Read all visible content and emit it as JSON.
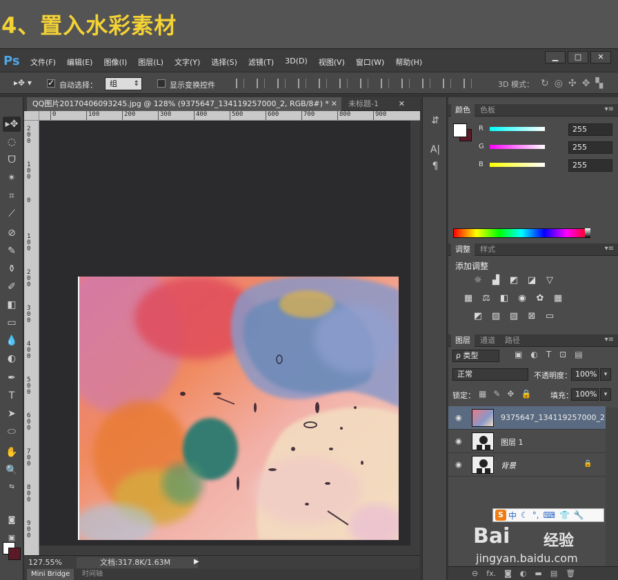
{
  "banner": {
    "title": "4、置入水彩素材"
  },
  "app": {
    "logo": "Ps",
    "menus": [
      "文件(F)",
      "编辑(E)",
      "图像(I)",
      "图层(L)",
      "文字(Y)",
      "选择(S)",
      "滤镜(T)",
      "3D(D)",
      "视图(V)",
      "窗口(W)",
      "帮助(H)"
    ],
    "window_buttons": [
      "▁",
      "□",
      "✕"
    ]
  },
  "options": {
    "tool_icon": "move-tool-icon",
    "auto_select_label": "自动选择：",
    "auto_select_checked": true,
    "auto_select_value": "组",
    "show_transform_label": "显示变换控件",
    "show_transform_checked": false,
    "mode3d_label": "3D 模式："
  },
  "document": {
    "active_tab": "QQ图片20170406093245.jpg @ 128% (9375647_134119257000_2, RGB/8#) *",
    "inactive_tab": "未标题-1",
    "ruler_top": [
      "0",
      "100",
      "200",
      "300",
      "400",
      "500",
      "600",
      "700",
      "800",
      "900"
    ],
    "ruler_left": [
      "2 0 0",
      "1 0 0",
      "0",
      "1 0 0",
      "2 0 0",
      "3 0 0",
      "4 0 0",
      "5 0 0",
      "6 0 0",
      "7 0 0",
      "8 0 0",
      "9 0 0"
    ],
    "zoom": "127.55%",
    "doc_info": "文档:317.8K/1.63M",
    "bottom_tabs": [
      "Mini Bridge",
      "时间轴"
    ]
  },
  "color_panel": {
    "tabs": [
      "颜色",
      "色板"
    ],
    "channels": [
      {
        "letter": "R",
        "value": "255"
      },
      {
        "letter": "G",
        "value": "255"
      },
      {
        "letter": "B",
        "value": "255"
      }
    ],
    "fg_color": "#ffffff",
    "bg_color": "#5a1a28"
  },
  "adjust_panel": {
    "tabs": [
      "调整",
      "样式"
    ],
    "title": "添加调整"
  },
  "layers_panel": {
    "tabs": [
      "图层",
      "通道",
      "路径"
    ],
    "filter": "ρ 类型",
    "blend_mode": "正常",
    "opacity_label": "不透明度：",
    "opacity_value": "100%",
    "lock_label": "锁定：",
    "fill_label": "填充：",
    "fill_value": "100%",
    "layers": [
      {
        "name": "9375647_134119257000_2",
        "selected": true
      },
      {
        "name": "图层 1",
        "selected": false
      },
      {
        "name": "背景",
        "selected": false,
        "locked": true
      }
    ]
  },
  "ime": {
    "label": "中"
  },
  "watermark": {
    "logo": "Bai",
    "logo2": "经验",
    "url": "jingyan.baidu.com"
  }
}
